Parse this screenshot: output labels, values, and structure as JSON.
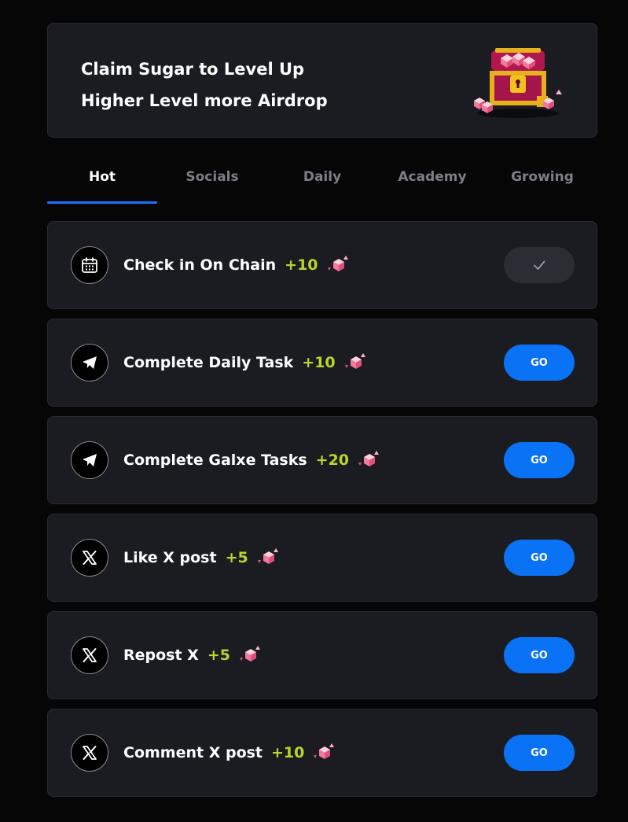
{
  "banner": {
    "line1": "Claim Sugar to Level Up",
    "line2": "Higher Level more Airdrop",
    "image": "treasure-chest-with-sugar-cubes"
  },
  "tabs": [
    {
      "label": "Hot",
      "active": true
    },
    {
      "label": "Socials",
      "active": false
    },
    {
      "label": "Daily",
      "active": false
    },
    {
      "label": "Academy",
      "active": false
    },
    {
      "label": "Growing",
      "active": false
    }
  ],
  "tasks": [
    {
      "icon": "calendar-icon",
      "label": "Check in On Chain",
      "points": "+10",
      "status": "done",
      "button": ""
    },
    {
      "icon": "telegram-icon",
      "label": "Complete Daily Task",
      "points": "+10",
      "status": "pending",
      "button": "GO"
    },
    {
      "icon": "telegram-icon",
      "label": "Complete Galxe Tasks",
      "points": "+20",
      "status": "pending",
      "button": "GO"
    },
    {
      "icon": "x-logo-icon",
      "label": "Like X post",
      "points": "+5",
      "status": "pending",
      "button": "GO"
    },
    {
      "icon": "x-logo-icon",
      "label": "Repost X",
      "points": "+5",
      "status": "pending",
      "button": "GO"
    },
    {
      "icon": "x-logo-icon",
      "label": "Comment X post",
      "points": "+10",
      "status": "pending",
      "button": "GO"
    }
  ],
  "colors": {
    "background": "#060607",
    "card": "#1b1c21",
    "accent_blue": "#0a72f5",
    "points_green": "#b8d62a",
    "tab_inactive": "#7d7f87"
  }
}
